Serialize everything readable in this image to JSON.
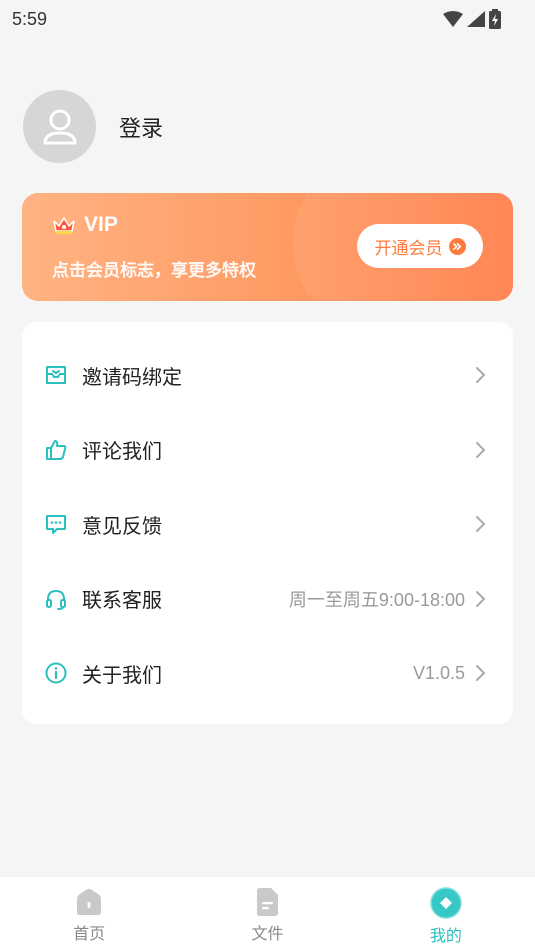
{
  "status_bar": {
    "time": "5:59"
  },
  "profile": {
    "login_label": "登录"
  },
  "vip_card": {
    "title": "VIP",
    "subtitle": "点击会员标志，享更多特权",
    "button_label": "开通会员"
  },
  "menu": {
    "items": [
      {
        "label": "邀请码绑定",
        "value": "",
        "icon": "invite-inbox-icon"
      },
      {
        "label": "评论我们",
        "value": "",
        "icon": "thumbs-up-icon"
      },
      {
        "label": "意见反馈",
        "value": "",
        "icon": "feedback-chat-icon"
      },
      {
        "label": "联系客服",
        "value": "周一至周五9:00-18:00",
        "icon": "headset-icon"
      },
      {
        "label": "关于我们",
        "value": "V1.0.5",
        "icon": "info-icon"
      }
    ]
  },
  "tab_bar": {
    "tabs": [
      {
        "label": "首页",
        "icon": "home-icon",
        "active": false
      },
      {
        "label": "文件",
        "icon": "file-icon",
        "active": false
      },
      {
        "label": "我的",
        "icon": "profile-diamond-icon",
        "active": true
      }
    ]
  },
  "colors": {
    "accent": "#2bbfbf",
    "vip_orange": "#ff8a52",
    "background": "#f5f5f5"
  }
}
